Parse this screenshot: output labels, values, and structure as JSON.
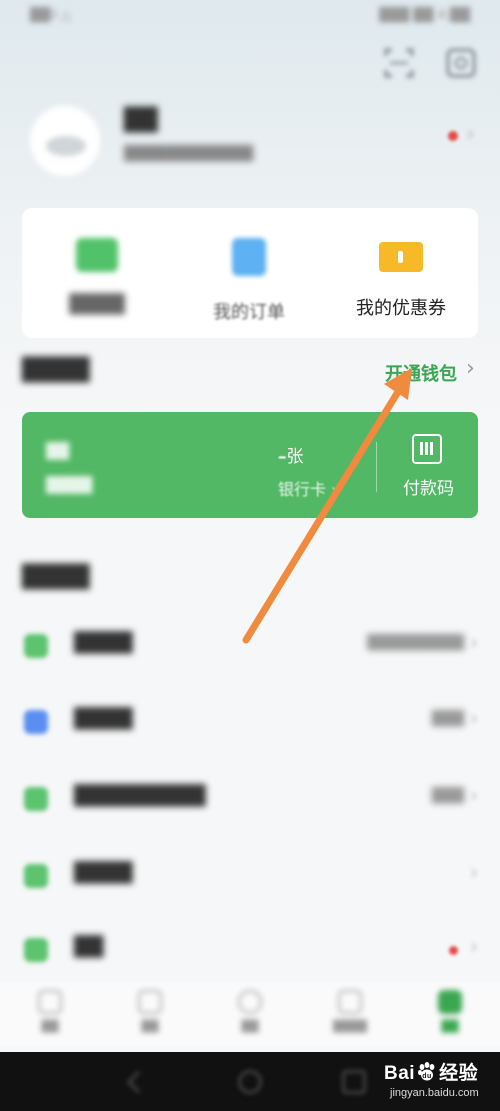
{
  "status_bar": {
    "left": "██il △",
    "right": "███ ██ 4:██"
  },
  "header": {
    "scan_icon": "scan-icon",
    "settings_icon": "settings-icon"
  },
  "profile": {
    "name": "██",
    "subtitle": "████████████",
    "has_red_dot": true
  },
  "quick_menu": {
    "items": [
      {
        "label": "████",
        "icon": "wallet-card-icon",
        "color": "#52c26a"
      },
      {
        "label": "我的订单",
        "icon": "order-clipboard-icon",
        "color": "#5eb1f2"
      },
      {
        "label": "我的优惠券",
        "icon": "coupon-ticket-icon",
        "color": "#f7b928"
      }
    ]
  },
  "wallet": {
    "title": "████",
    "open_link": "开通钱包",
    "card": {
      "left_top": "██",
      "left_bottom": "████",
      "count_prefix": "–",
      "count_unit": "张",
      "bank_card_label": "银行卡 ›",
      "pay_code_label": "付款码",
      "color": "#52b865"
    }
  },
  "services": {
    "title": "████",
    "rows": [
      {
        "label": "████",
        "value": "█████████",
        "icon_color": "#5cc36f",
        "dot": false
      },
      {
        "label": "████",
        "value": "███",
        "icon_color": "#5b8ef2",
        "dot": false
      },
      {
        "label": "█████████",
        "value": "███",
        "icon_color": "#5cc36f",
        "dot": false
      },
      {
        "label": "████",
        "value": "",
        "icon_color": "#5cc36f",
        "dot": false
      },
      {
        "label": "██",
        "value": "",
        "icon_color": "#5cc36f",
        "dot": true
      }
    ]
  },
  "tab_bar": {
    "tabs": [
      {
        "label": "██",
        "active": false
      },
      {
        "label": "██",
        "active": false
      },
      {
        "label": "██",
        "active": false
      },
      {
        "label": "████",
        "active": false
      },
      {
        "label": "██",
        "active": true
      }
    ]
  },
  "watermark": {
    "brand_left": "Bai",
    "brand_right": "经验",
    "url": "jingyan.baidu.com"
  },
  "annotation": {
    "arrow_color": "#f08a3e"
  }
}
